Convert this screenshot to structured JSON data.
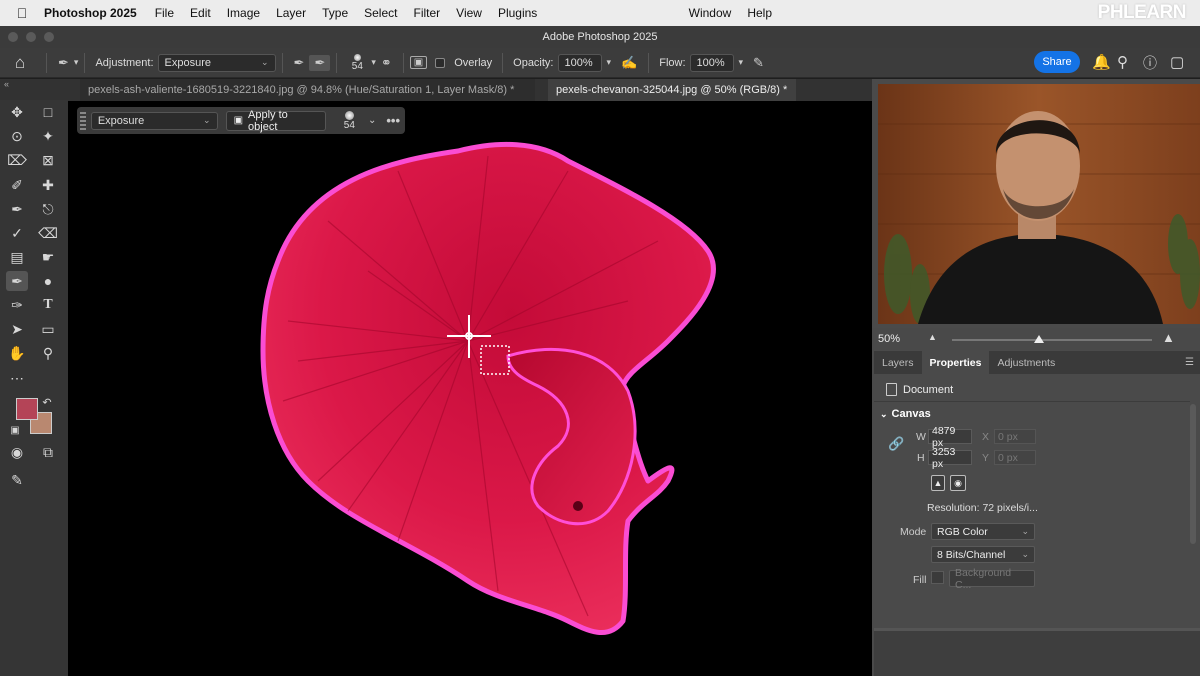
{
  "menubar": {
    "app_name": "Photoshop 2025",
    "items": [
      "File",
      "Edit",
      "Image",
      "Layer",
      "Type",
      "Select",
      "Filter",
      "View",
      "Plugins"
    ],
    "right_items": [
      "Window",
      "Help"
    ],
    "watermark": "PHLEARN"
  },
  "window": {
    "title": "Adobe Photoshop 2025"
  },
  "options_bar": {
    "adjustment_label": "Adjustment:",
    "adjustment_value": "Exposure",
    "brush_size": "54",
    "overlay_label": "Overlay",
    "opacity_label": "Opacity:",
    "opacity_value": "100%",
    "flow_label": "Flow:",
    "flow_value": "100%",
    "share_label": "Share"
  },
  "tabs": [
    {
      "label": "pexels-ash-valiente-1680519-3221840.jpg @ 94.8% (Hue/Saturation 1, Layer Mask/8) *"
    },
    {
      "label": "pexels-chevanon-325044.jpg @ 50% (RGB/8) *"
    }
  ],
  "context_bar": {
    "adjustment_value": "Exposure",
    "apply_label": "Apply to object",
    "brush_size": "54",
    "more": "•••"
  },
  "navigator": {
    "zoom": "50%"
  },
  "panel": {
    "tabs": [
      "Layers",
      "Properties",
      "Adjustments"
    ],
    "active_tab": "Properties",
    "doc_label": "Document",
    "section": "Canvas",
    "w_label": "W",
    "w_value": "4879 px",
    "h_label": "H",
    "h_value": "3253 px",
    "x_label": "X",
    "x_value": "0 px",
    "y_label": "Y",
    "y_value": "0 px",
    "resolution": "Resolution: 72 pixels/i...",
    "mode_label": "Mode",
    "mode_value": "RGB Color",
    "bits_value": "8 Bits/Channel",
    "fill_label": "Fill",
    "fill_value": "Background C..."
  },
  "colors": {
    "foreground": "#b44457",
    "background": "#b98870",
    "accent": "#1473e6",
    "fish": "#e0194a",
    "outline": "#ff4fd8"
  }
}
